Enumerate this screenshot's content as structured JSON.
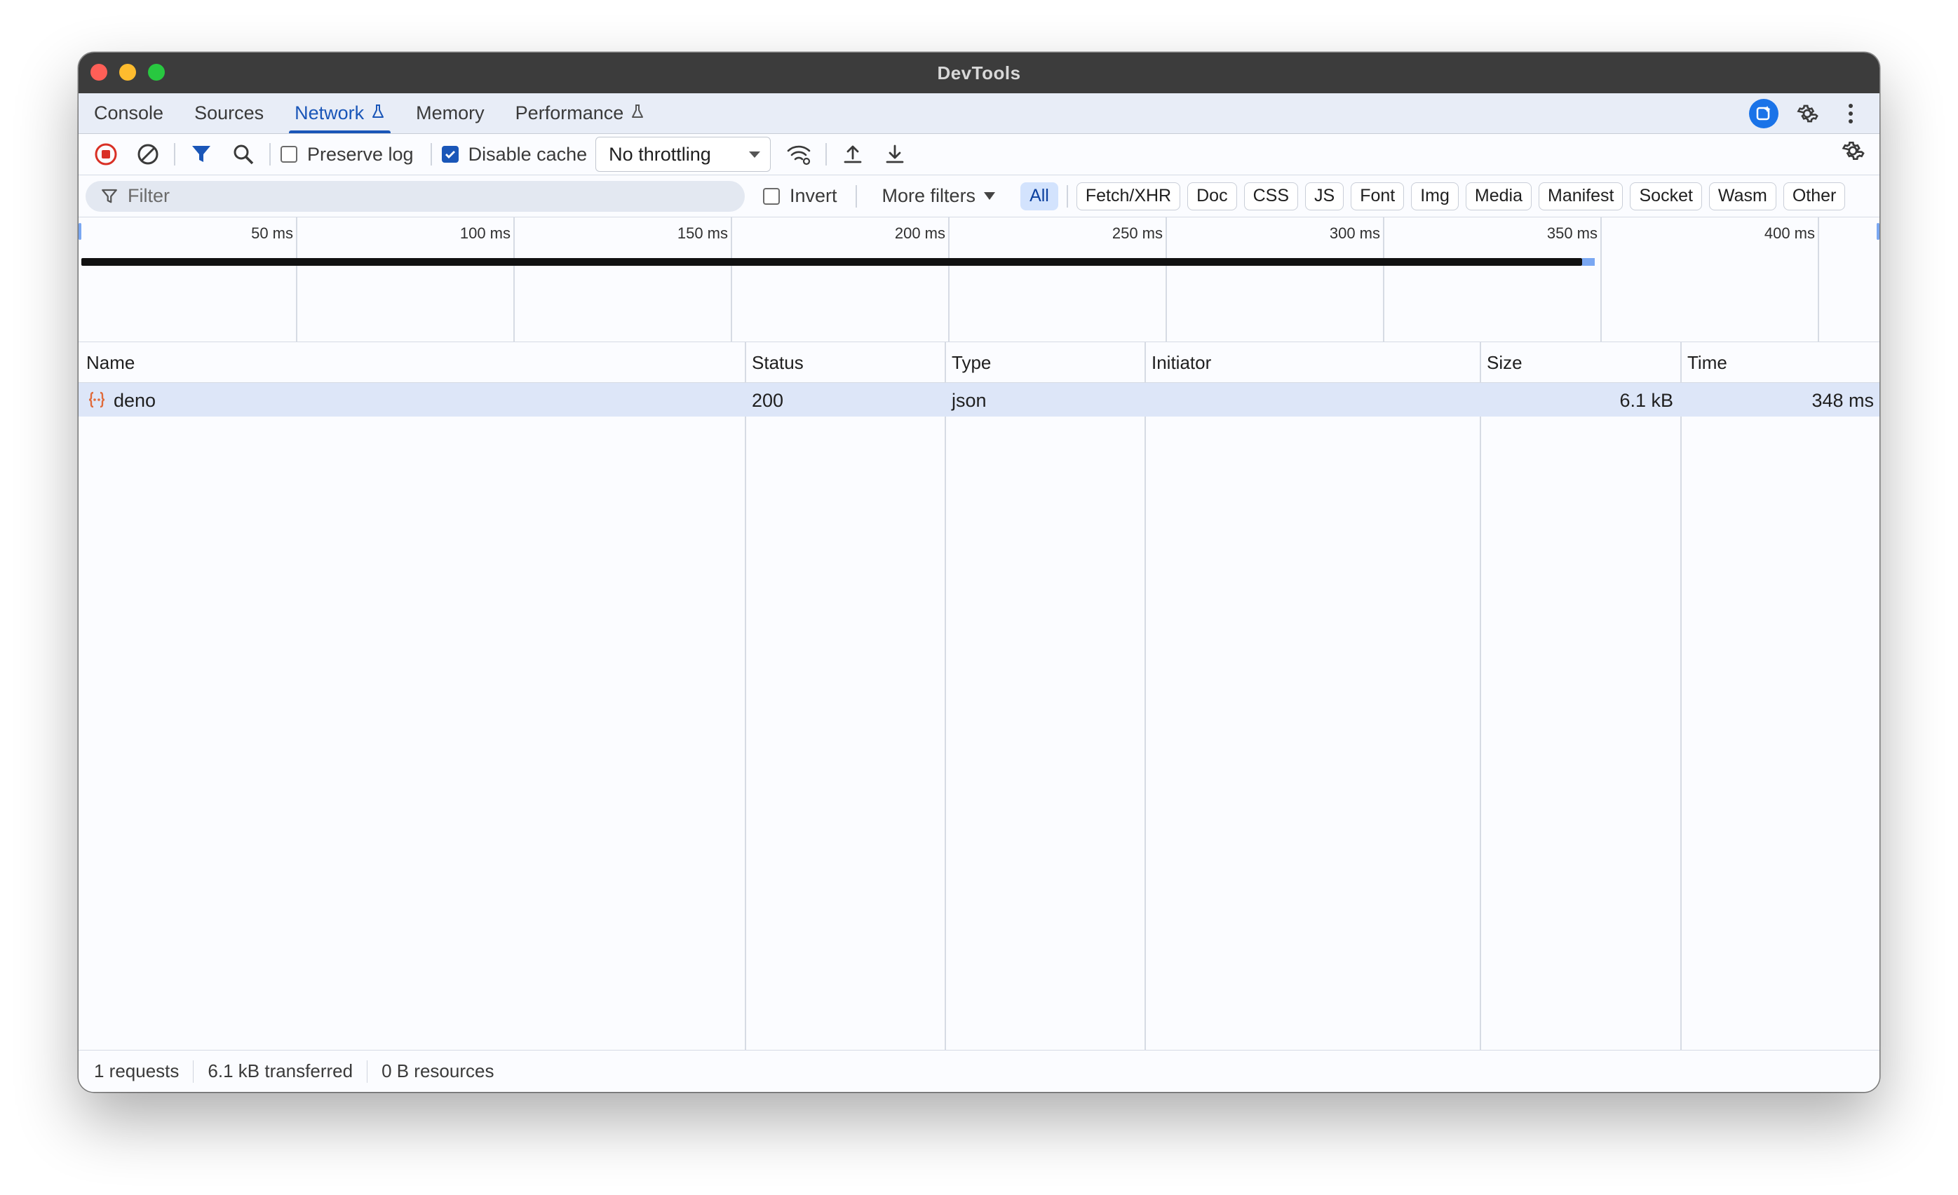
{
  "window": {
    "title": "DevTools"
  },
  "tabs": [
    {
      "label": "Console",
      "experimental": false
    },
    {
      "label": "Sources",
      "experimental": false
    },
    {
      "label": "Network",
      "experimental": true,
      "active": true
    },
    {
      "label": "Memory",
      "experimental": false
    },
    {
      "label": "Performance",
      "experimental": true
    }
  ],
  "toolbar": {
    "preserve_log_label": "Preserve log",
    "preserve_log_checked": false,
    "disable_cache_label": "Disable cache",
    "disable_cache_checked": true,
    "throttling_value": "No throttling"
  },
  "filter": {
    "placeholder": "Filter",
    "invert_label": "Invert",
    "invert_checked": false,
    "more_filters_label": "More filters",
    "chips": [
      "All",
      "Fetch/XHR",
      "Doc",
      "CSS",
      "JS",
      "Font",
      "Img",
      "Media",
      "Manifest",
      "Socket",
      "Wasm",
      "Other"
    ],
    "active_chip": "All"
  },
  "overview": {
    "ticks": [
      "50 ms",
      "100 ms",
      "150 ms",
      "200 ms",
      "250 ms",
      "300 ms",
      "350 ms",
      "400 ms"
    ],
    "request_end_ms": 348
  },
  "table": {
    "columns": [
      "Name",
      "Status",
      "Type",
      "Initiator",
      "Size",
      "Time"
    ],
    "rows": [
      {
        "name": "deno",
        "status": "200",
        "type": "json",
        "initiator": "",
        "size": "6.1 kB",
        "time": "348 ms",
        "icon": "json-icon"
      }
    ]
  },
  "status": {
    "requests": "1 requests",
    "transferred": "6.1 kB transferred",
    "resources": "0 B resources"
  },
  "colors": {
    "accent": "#1a56b8",
    "selected_row": "#dde6f8",
    "record_red": "#d93025"
  }
}
